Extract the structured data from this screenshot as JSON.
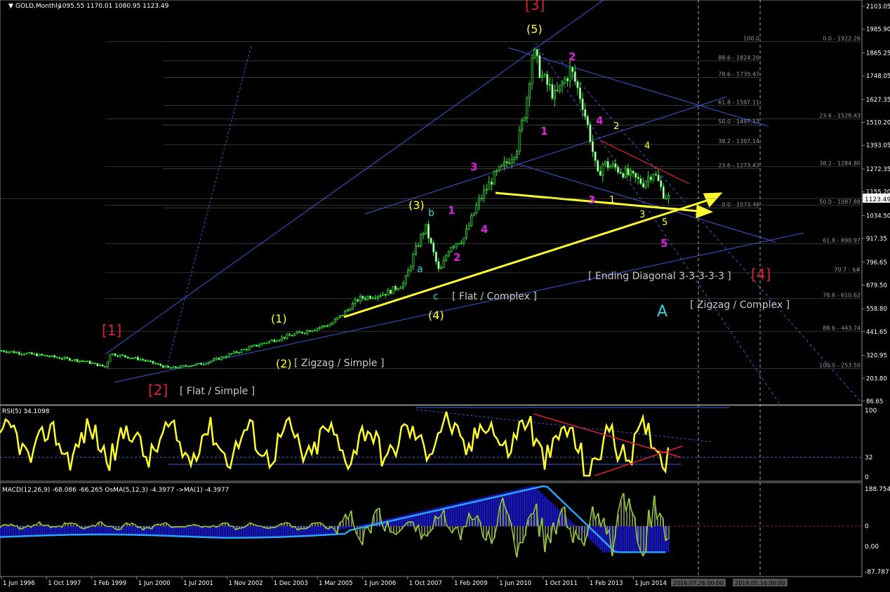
{
  "chart_data": [
    {
      "type": "candlestick",
      "symbol_label": "GOLD,Monthly",
      "ohlc_last": [
        "1095.55",
        "1170.01",
        "1080.95",
        "1123.49"
      ],
      "price_axis_ticks": [
        "2103.05",
        "1985.90",
        "1865.25",
        "1748.05",
        "1627.35",
        "1510.20",
        "1393.05",
        "1272.35",
        "1155.20",
        "1034.50",
        "917.35",
        "796.65",
        "679.50",
        "558.80",
        "441.65",
        "320.95",
        "203.80",
        "86.65"
      ],
      "last_price": "1123.49",
      "date_axis_ticks": [
        "1 Jun 1996",
        "1 Oct 1997",
        "1 Feb 1999",
        "1 Jun 2000",
        "1 Jul 2001",
        "1 Nov 2002",
        "1 Dec 2003",
        "1 Mar 2005",
        "1 Jun 2006",
        "1 Oct 2007",
        "1 Feb 2009",
        "1 Jun 2010",
        "1 Oct 2011",
        "1 Feb 2013",
        "1 Jun 2014"
      ],
      "future_date_labels": [
        "2016.07.26 00:00",
        "2018.05.16 00:00"
      ],
      "fib_levels_left": [
        {
          "label": "100.0",
          "price": 1922.26
        },
        {
          "label": "88.6 - 1824.20",
          "price": 1824.2
        },
        {
          "label": "78.6 - 1739.47",
          "price": 1739.47
        },
        {
          "label": "61.8 - 1597.11",
          "price": 1597.11
        },
        {
          "label": "50.0 - 1497.13",
          "price": 1497.13
        },
        {
          "label": "38.2 - 1397.14",
          "price": 1397.14
        },
        {
          "label": "23.6 - 1273.43",
          "price": 1273.43
        },
        {
          "label": "0.0 - 1073.46",
          "price": 1073.46
        }
      ],
      "fib_levels_right": [
        {
          "label": "0.0 - 1922.26",
          "price": 1922.26
        },
        {
          "label": "23.6 - 1528.43",
          "price": 1528.43
        },
        {
          "label": "38.2 - 1284.80",
          "price": 1284.8
        },
        {
          "label": "50.0 - 1087.88",
          "price": 1087.88
        },
        {
          "label": "61.8 - 890.97",
          "price": 890.97
        },
        {
          "label": "70.7 - $#",
          "price": 742.43
        },
        {
          "label": "78.6 - 610.62",
          "price": 610.62
        },
        {
          "label": "88.6 - 443.74",
          "price": 443.74
        },
        {
          "label": "100.0 - 253.50",
          "price": 253.5
        }
      ],
      "wave_labels": {
        "major": [
          "[1]",
          "[2]",
          "[3]",
          "[4]"
        ],
        "intermediate": [
          "(1)",
          "(2)",
          "(3)",
          "(4)",
          "(5)"
        ],
        "minor_abc": [
          "a",
          "b",
          "c",
          "A"
        ],
        "minor_numbers": [
          "1",
          "2",
          "3",
          "4",
          "1",
          "2",
          "3",
          "4",
          "5",
          "1",
          "2",
          "3",
          "4",
          "5"
        ]
      },
      "annotations": [
        "[ Flat / Simple ]",
        "[ Zigzag / Simple ]",
        "[ Flat / Complex ]",
        "[ Ending Diagonal 3-3-3-3-3 ]",
        "[ Zigzag / Complex ]"
      ]
    },
    {
      "type": "line",
      "title": "RSI(5) 34.1098",
      "levels": [
        "100",
        "32",
        "0"
      ],
      "color": "#ffff00"
    },
    {
      "type": "bar",
      "title": "MACD(12,26,9) -68.086 -66.265  OsMA(5,12,3) -4.3977  ->MA(1) -4.3977",
      "axis_labels": [
        "188.754",
        "0",
        "0.00",
        "-87.787"
      ]
    }
  ]
}
